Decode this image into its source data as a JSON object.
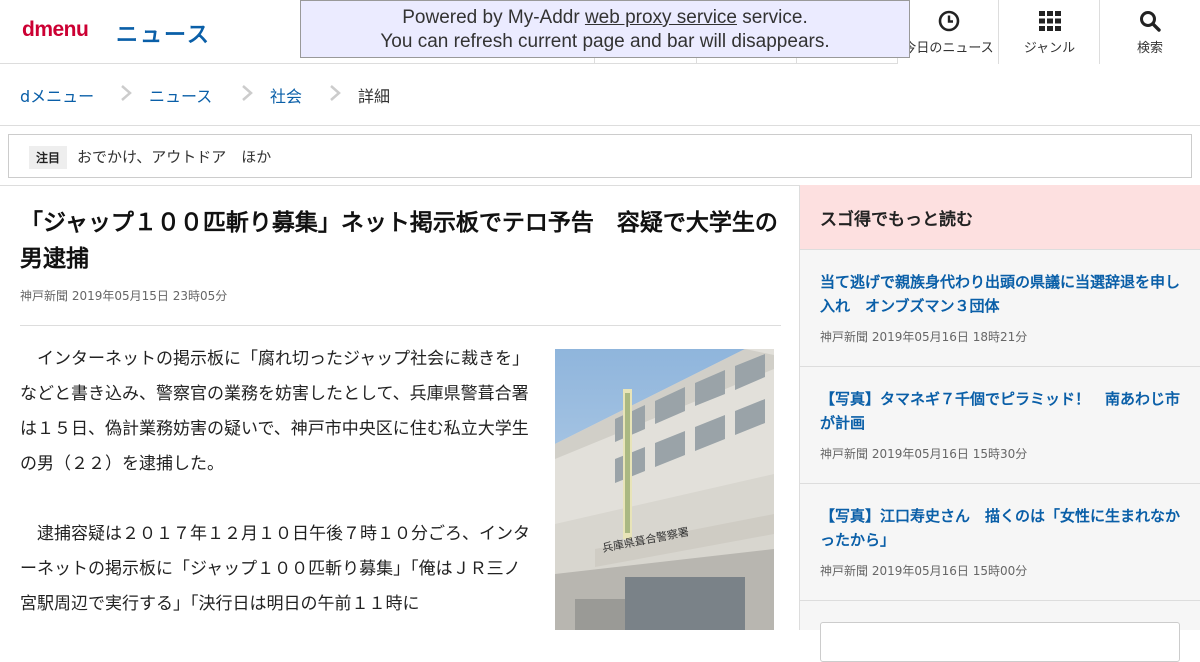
{
  "header": {
    "logo": "dmenu",
    "section": "ニュース",
    "nav": [
      {
        "label": "今日のニュース",
        "icon": "clock-icon"
      },
      {
        "label": "ジャンル",
        "icon": "grid-icon"
      },
      {
        "label": "検索",
        "icon": "search-icon"
      }
    ]
  },
  "proxy_bar": {
    "line1_pre": "Powered by My-Addr ",
    "line1_link": "web proxy service",
    "line1_post": " service.",
    "line2": "You can refresh current page and bar will disappears."
  },
  "breadcrumb": [
    "dメニュー",
    "ニュース",
    "社会",
    "詳細"
  ],
  "notice": {
    "tag": "注目",
    "text": "おでかけ、アウトドア　ほか"
  },
  "article": {
    "title": "「ジャップ１００匹斬り募集」ネット掲示板でテロ予告　容疑で大学生の男逮捕",
    "source": "神戸新聞",
    "date": "2019年05月15日",
    "time": "23時05分",
    "paragraph1": "　インターネットの掲示板に「腐れ切ったジャップ社会に裁きを」などと書き込み、警察官の業務を妨害したとして、兵庫県警葺合署は１５日、偽計業務妨害の疑いで、神戸市中央区に住む私立大学生の男（２２）を逮捕した。",
    "paragraph2": "　逮捕容疑は２０１７年１２月１０日午後７時１０分ごろ、インターネットの掲示板に「ジャップ１００匹斬り募集」「俺はＪＲ三ノ宮駅周辺で実行する」「決行日は明日の午前１１時に",
    "photo_sign": "兵庫県葺合警察署"
  },
  "sidebar": {
    "heading": "スゴ得でもっと読む",
    "items": [
      {
        "title": "当て逃げで親族身代わり出頭の県議に当選辞退を申し入れ　オンブズマン３団体",
        "source": "神戸新聞",
        "date": "2019年05月16日",
        "time": "18時21分"
      },
      {
        "title": "【写真】タマネギ７千個でピラミッド！　南あわじ市が計画",
        "source": "神戸新聞",
        "date": "2019年05月16日",
        "time": "15時30分"
      },
      {
        "title": "【写真】江口寿史さん　描くのは「女性に生まれなかったから」",
        "source": "神戸新聞",
        "date": "2019年05月16日",
        "time": "15時00分"
      }
    ]
  },
  "colors": {
    "brand": "#cc0033",
    "link": "#0a5fa8",
    "sidebar_head_bg": "#fde0e0",
    "proxy_bg": "#ebebff"
  }
}
